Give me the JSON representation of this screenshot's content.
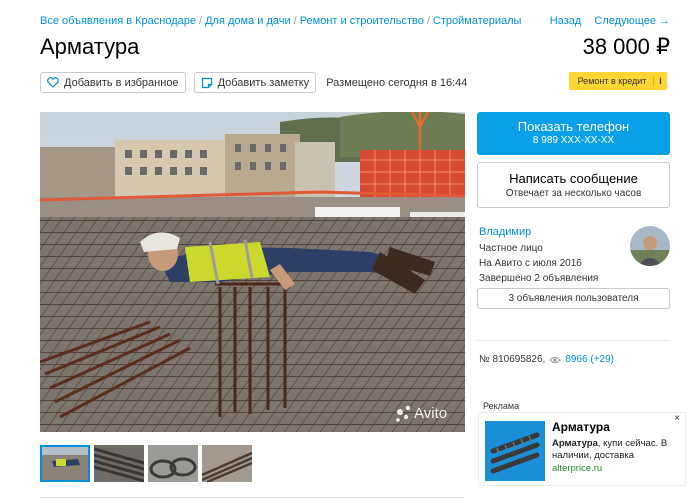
{
  "breadcrumbs": [
    "Все объявления в Краснодаре",
    "Для дома и дачи",
    "Ремонт и строительство",
    "Стройматериалы"
  ],
  "breadcrumb_sep": "/",
  "pager": {
    "back": "Назад",
    "next": "Следующее →"
  },
  "title": "Арматура",
  "price": "38 000 ₽",
  "actions": {
    "favorite": "Добавить в избранное",
    "note": "Добавить заметку",
    "posted": "Размещено сегодня в 16:44"
  },
  "credit": {
    "label": "Ремонт в кредит",
    "info": "i"
  },
  "photo": {
    "watermark": "Avito"
  },
  "contact": {
    "call_label": "Показать телефон",
    "phone": "8 989 XXX-XX-XX",
    "message_label": "Написать сообщение",
    "message_sub": "Отвечает за несколько часов"
  },
  "seller": {
    "name": "Владимир",
    "type": "Частное лицо",
    "since": "На Авито с июля 2016",
    "completed": "Завершено 2 объявления",
    "ads_button": "3 объявления пользователя"
  },
  "stats": {
    "item_id": "№ 810695826,",
    "views": "8966 (+29)"
  },
  "ad": {
    "label": "Реклама",
    "close": "×",
    "title": "Арматура",
    "text_bold": "Арматура",
    "text_rest": ", купи сейчас. В наличии, доставка",
    "url": "alterprice.ru"
  },
  "colors": {
    "link": "#0091d9",
    "call_button": "#0aa0e8",
    "credit_badge": "#ffd633",
    "ad_url": "#2a8a2a"
  }
}
